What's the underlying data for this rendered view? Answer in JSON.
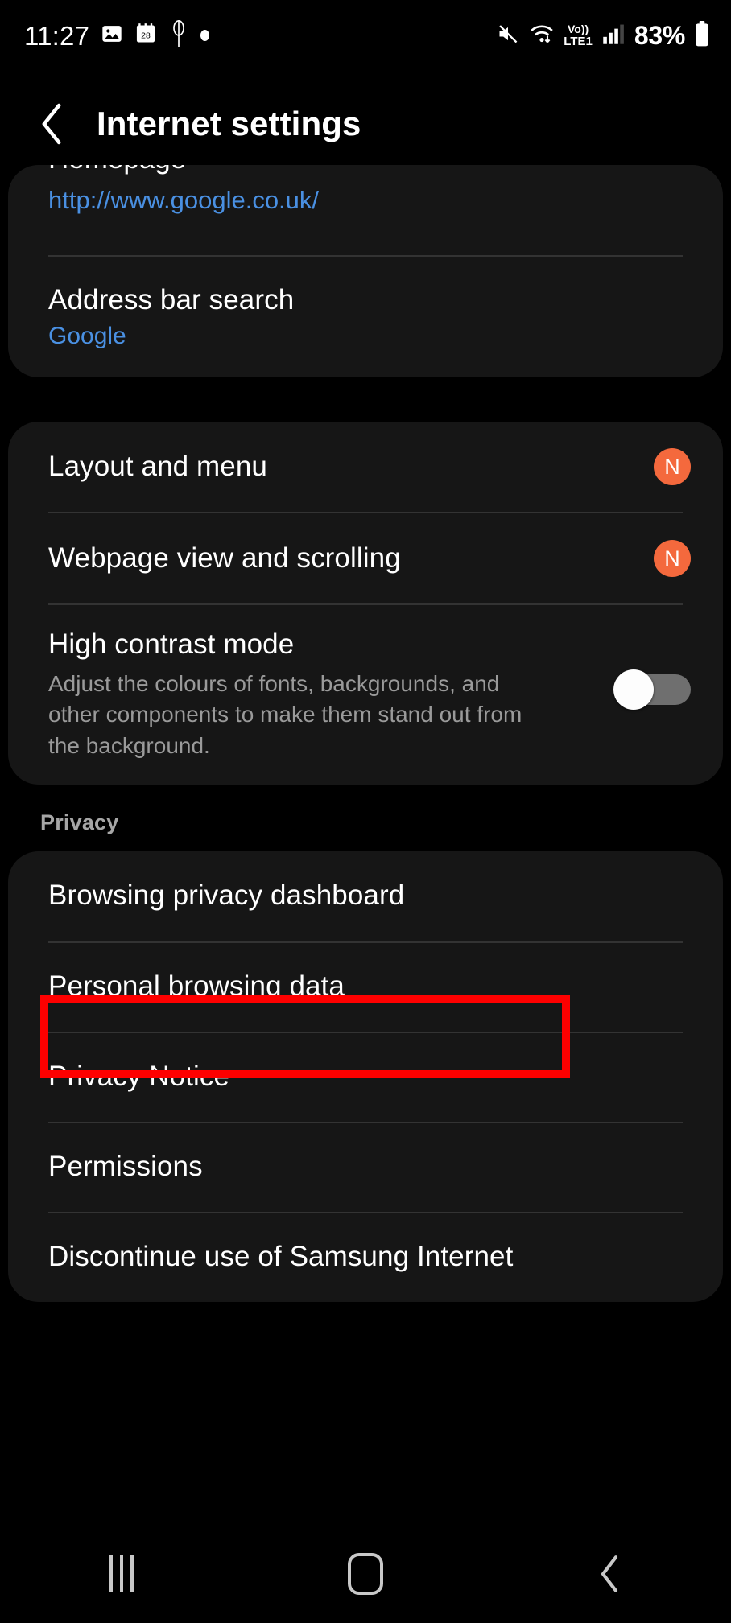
{
  "status_bar": {
    "time": "11:27",
    "left_icons": [
      "image-icon",
      "calendar-icon",
      "music-note-icon",
      "dot-icon"
    ],
    "calendar_day": "28",
    "right_icons": [
      "mute-icon",
      "wifi-icon",
      "signal-icon",
      "battery-icon"
    ],
    "volte_line1": "Vo))",
    "volte_line2": "LTE1",
    "battery_percent": "83%"
  },
  "header": {
    "title": "Internet settings",
    "back_icon": "chevron-left-icon"
  },
  "cards": {
    "card1": {
      "clipped_row": {
        "ghost_title": "Homepage",
        "link": "http://www.google.co.uk/"
      },
      "address_bar_search": {
        "title": "Address bar search",
        "value": "Google"
      }
    },
    "card2": {
      "rows": [
        {
          "title": "Layout and menu",
          "badge": "N"
        },
        {
          "title": "Webpage view and scrolling",
          "badge": "N"
        }
      ],
      "high_contrast": {
        "title": "High contrast mode",
        "description": "Adjust the colours of fonts, backgrounds, and other components to make them stand out from the background.",
        "toggle_state": "off"
      }
    },
    "privacy_section": {
      "label": "Privacy",
      "rows": [
        {
          "title": "Browsing privacy dashboard"
        },
        {
          "title": "Personal browsing data"
        },
        {
          "title": "Privacy Notice"
        },
        {
          "title": "Permissions"
        },
        {
          "title": "Discontinue use of Samsung Internet"
        }
      ]
    }
  },
  "annotation": {
    "color": "#fe0000",
    "target": "Browsing privacy dashboard"
  },
  "nav_bar": {
    "recents_icon": "recents-icon",
    "home_icon": "home-icon",
    "back_icon": "chevron-left-icon"
  },
  "colors": {
    "background": "#000000",
    "card": "#161616",
    "link": "#4a90e2",
    "badge": "#f4693d",
    "divider": "#333333",
    "secondary_text": "#9a9a9a"
  }
}
